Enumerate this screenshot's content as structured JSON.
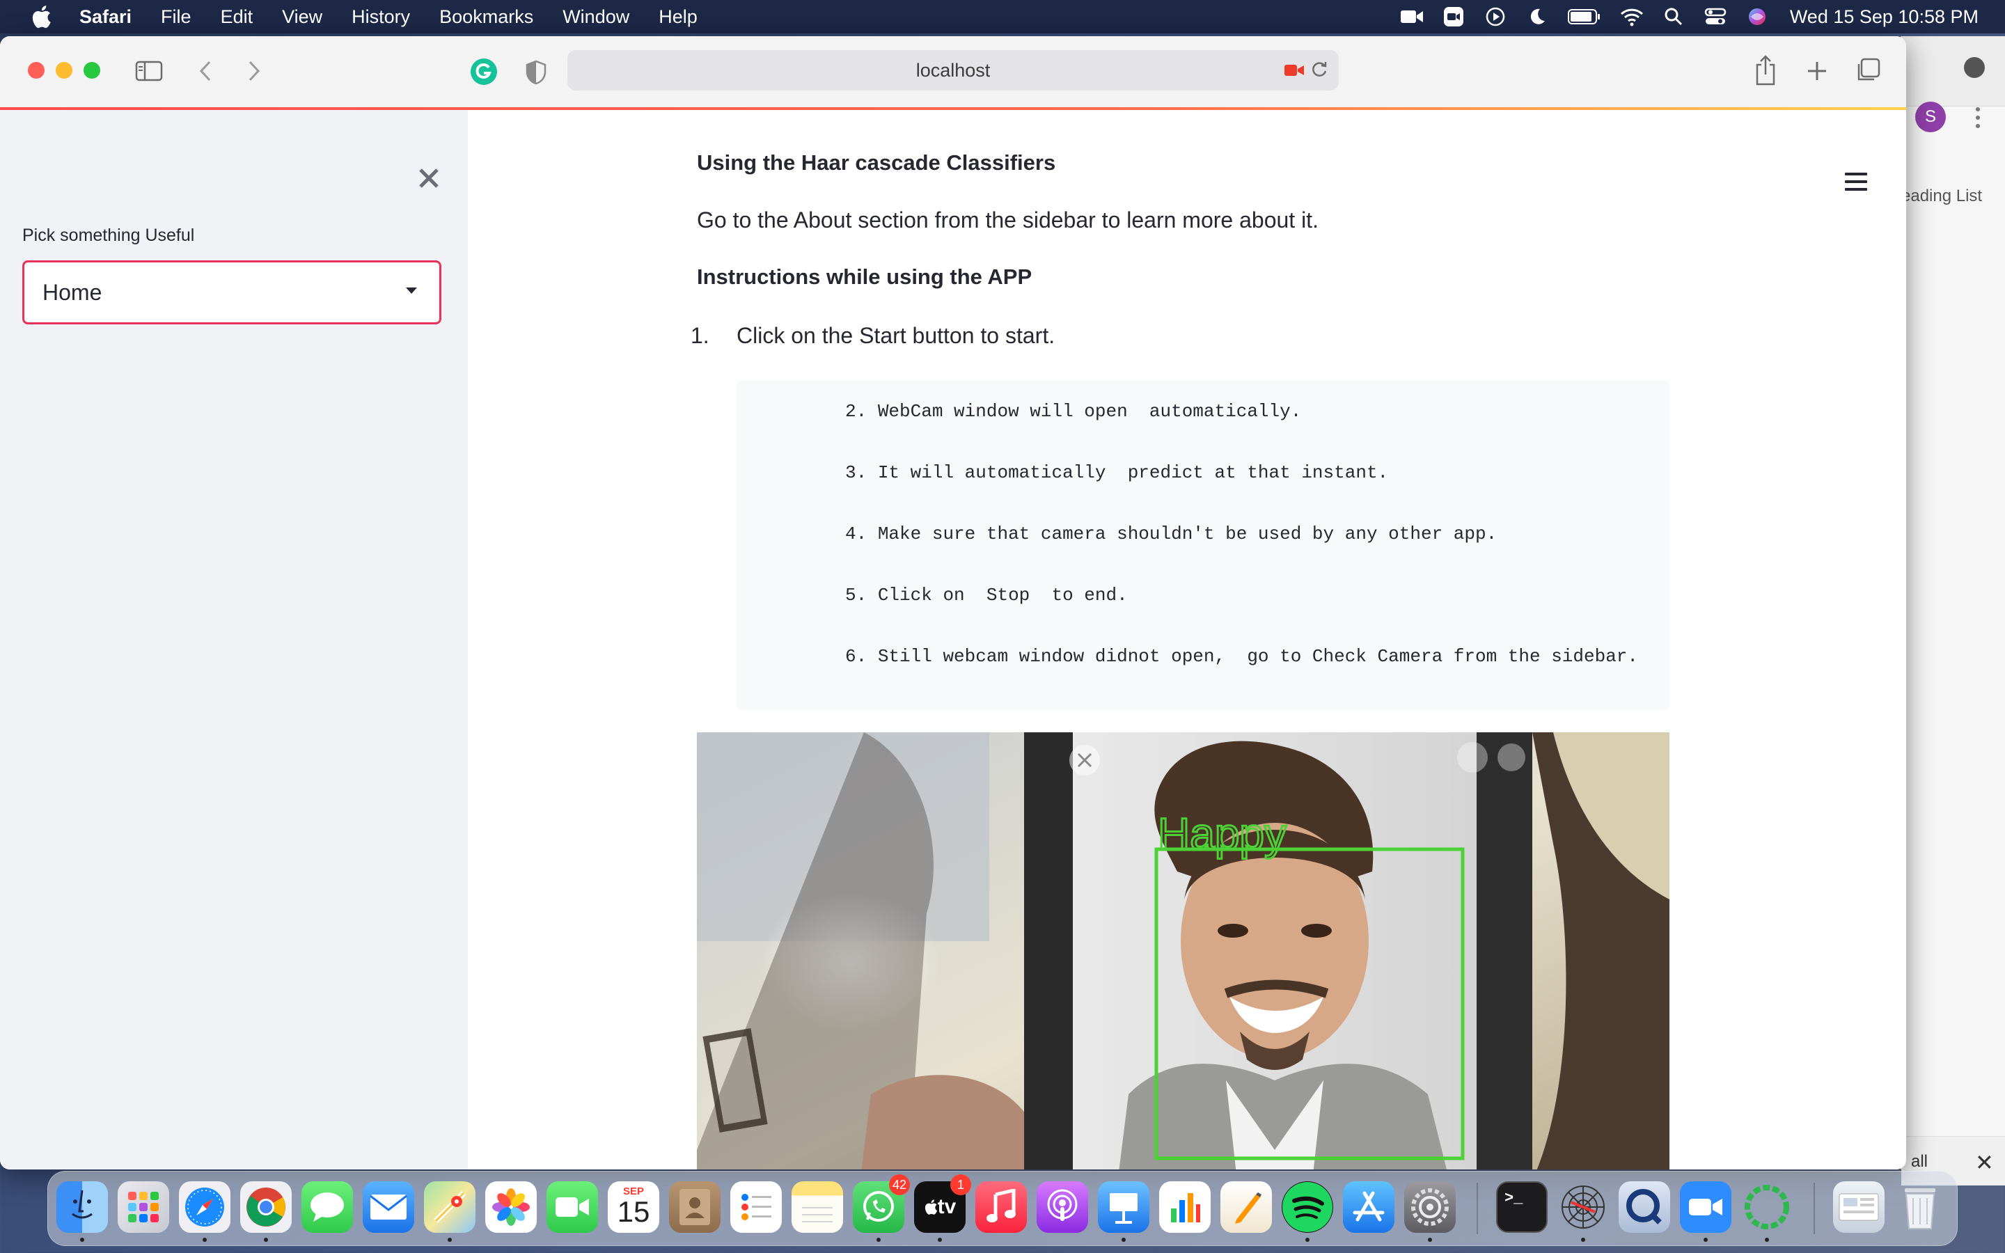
{
  "menubar": {
    "app_name": "Safari",
    "items": [
      "File",
      "Edit",
      "View",
      "History",
      "Bookmarks",
      "Window",
      "Help"
    ],
    "clock": "Wed 15 Sep  10:58 PM",
    "status_icons": [
      "facetime-icon",
      "zoom-icon",
      "play-icon",
      "moon-icon",
      "battery-icon",
      "wifi-icon",
      "search-icon",
      "control-center-icon",
      "siri-icon"
    ]
  },
  "browser": {
    "url": "localhost"
  },
  "behind_window": {
    "avatar_letter": "S",
    "reading_list": "eading List",
    "view_all": "all"
  },
  "sidebar": {
    "label": "Pick something Useful",
    "select_value": "Home"
  },
  "main": {
    "heading1": "Using the Haar cascade Classifiers",
    "paragraph1": "Go to the About section from the sidebar to learn more about it.",
    "heading2": "Instructions while using the APP",
    "list_number": "1.",
    "list_item": "Click on the Start button to start.",
    "code_lines": [
      "          2. WebCam window will open  automatically.",
      "          3. It will automatically  predict at that instant.",
      "          4. Make sure that camera shouldn't be used by any other app.",
      "          5. Click on  Stop  to end.",
      "          6. Still webcam window didnot open,  go to Check Camera from the sidebar."
    ],
    "webcam_label": "Happy"
  },
  "dock": {
    "calendar_month": "SEP",
    "calendar_day": "15",
    "whatsapp_badge": "42",
    "appletv_badge": "1",
    "appletv_label": "tv"
  },
  "colors": {
    "accent": "#e6335a",
    "detect_box": "#4cd137"
  }
}
